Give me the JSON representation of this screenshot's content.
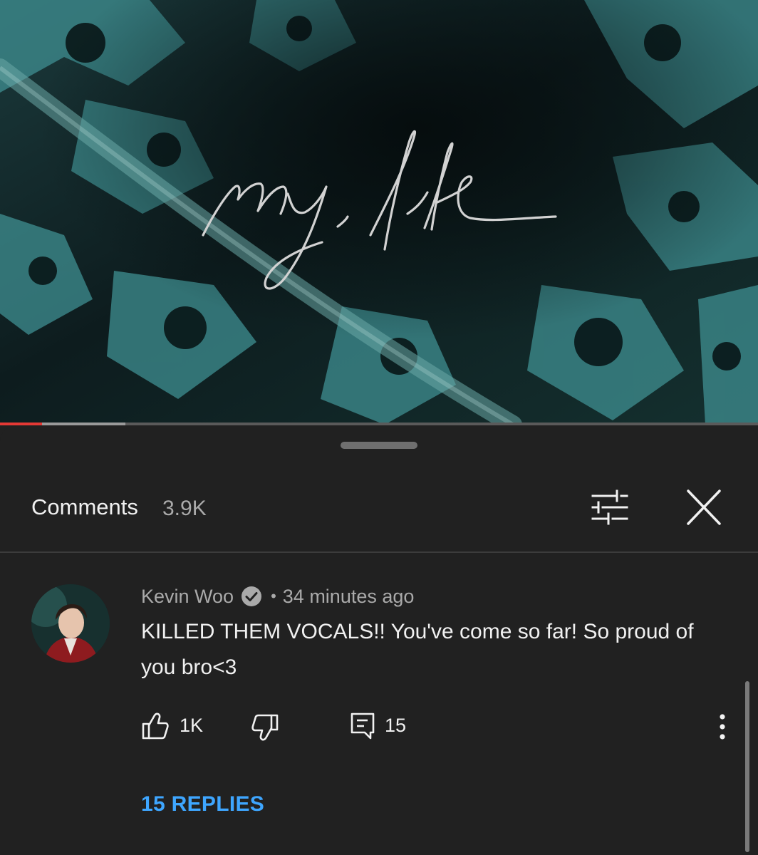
{
  "video": {
    "title_overlay": "my life",
    "progress": {
      "played": 0.055,
      "buffered": 0.165
    }
  },
  "comments_panel": {
    "title": "Comments",
    "count": "3.9K",
    "filter_icon": "sort-sliders-icon",
    "close_icon": "close-icon"
  },
  "comment": {
    "author": "Kevin Woo",
    "verified_icon": "verified-check-icon",
    "separator": "•",
    "time": "34 minutes ago",
    "text": "KILLED THEM VOCALS!! You've come so far! So proud of you bro<3",
    "likes": "1K",
    "replies_count": "15",
    "replies_link": "15 REPLIES"
  },
  "colors": {
    "accent_link": "#3ea6ff",
    "progress_played": "#e53935",
    "sheet_bg": "#212121"
  }
}
